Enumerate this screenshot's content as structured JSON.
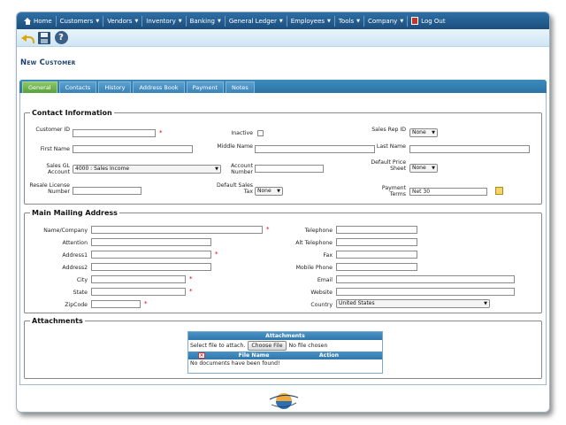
{
  "nav": {
    "items": [
      "Home",
      "Customers",
      "Vendors",
      "Inventory",
      "Banking",
      "General Ledger",
      "Employees",
      "Tools",
      "Company",
      "Log Out"
    ]
  },
  "page_title": "New Customer",
  "tabs": [
    "General",
    "Contacts",
    "History",
    "Address Book",
    "Payment",
    "Notes"
  ],
  "contact": {
    "legend": "Contact Information",
    "customer_id_label": "Customer ID",
    "inactive_label": "Inactive",
    "sales_rep_label": "Sales Rep ID",
    "sales_rep_value": "None",
    "first_name_label": "First Name",
    "middle_name_label": "Middle Name",
    "last_name_label": "Last Name",
    "gl_account_label": "Sales GL Account",
    "gl_account_value": "4000 : Sales Income",
    "account_number_label": "Account Number",
    "price_sheet_label": "Default Price Sheet",
    "price_sheet_value": "None",
    "resale_label": "Resale License Number",
    "sales_tax_label": "Default Sales Tax",
    "sales_tax_value": "None",
    "payment_terms_label": "Payment Terms",
    "payment_terms_value": "Net 30"
  },
  "address": {
    "legend": "Main Mailing Address",
    "name_company_label": "Name/Company",
    "attention_label": "Attention",
    "address1_label": "Address1",
    "address2_label": "Address2",
    "city_label": "City",
    "state_label": "State",
    "zip_label": "ZipCode",
    "telephone_label": "Telephone",
    "alt_telephone_label": "Alt Telephone",
    "fax_label": "Fax",
    "mobile_label": "Mobile Phone",
    "email_label": "Email",
    "website_label": "Website",
    "country_label": "Country",
    "country_value": "United States"
  },
  "attachments": {
    "legend": "Attachments",
    "table_title": "Attachments",
    "select_label": "Select file to attach.",
    "choose_button": "Choose File",
    "no_file": "No file chosen",
    "col_file": "File Name",
    "col_action": "Action",
    "empty_message": "No documents have been found!"
  },
  "required_mark": "*",
  "colors": {
    "nav_bg": "#1c4e7d",
    "tab_active": "#5aa03d",
    "tab_bg": "#3b82b6",
    "title": "#1a3f6b",
    "required": "#dd0000"
  },
  "icons": [
    "home-icon",
    "logout-icon",
    "back-icon",
    "save-icon",
    "help-icon",
    "edit-pencil-icon",
    "delete-icon",
    "company-logo-icon"
  ]
}
